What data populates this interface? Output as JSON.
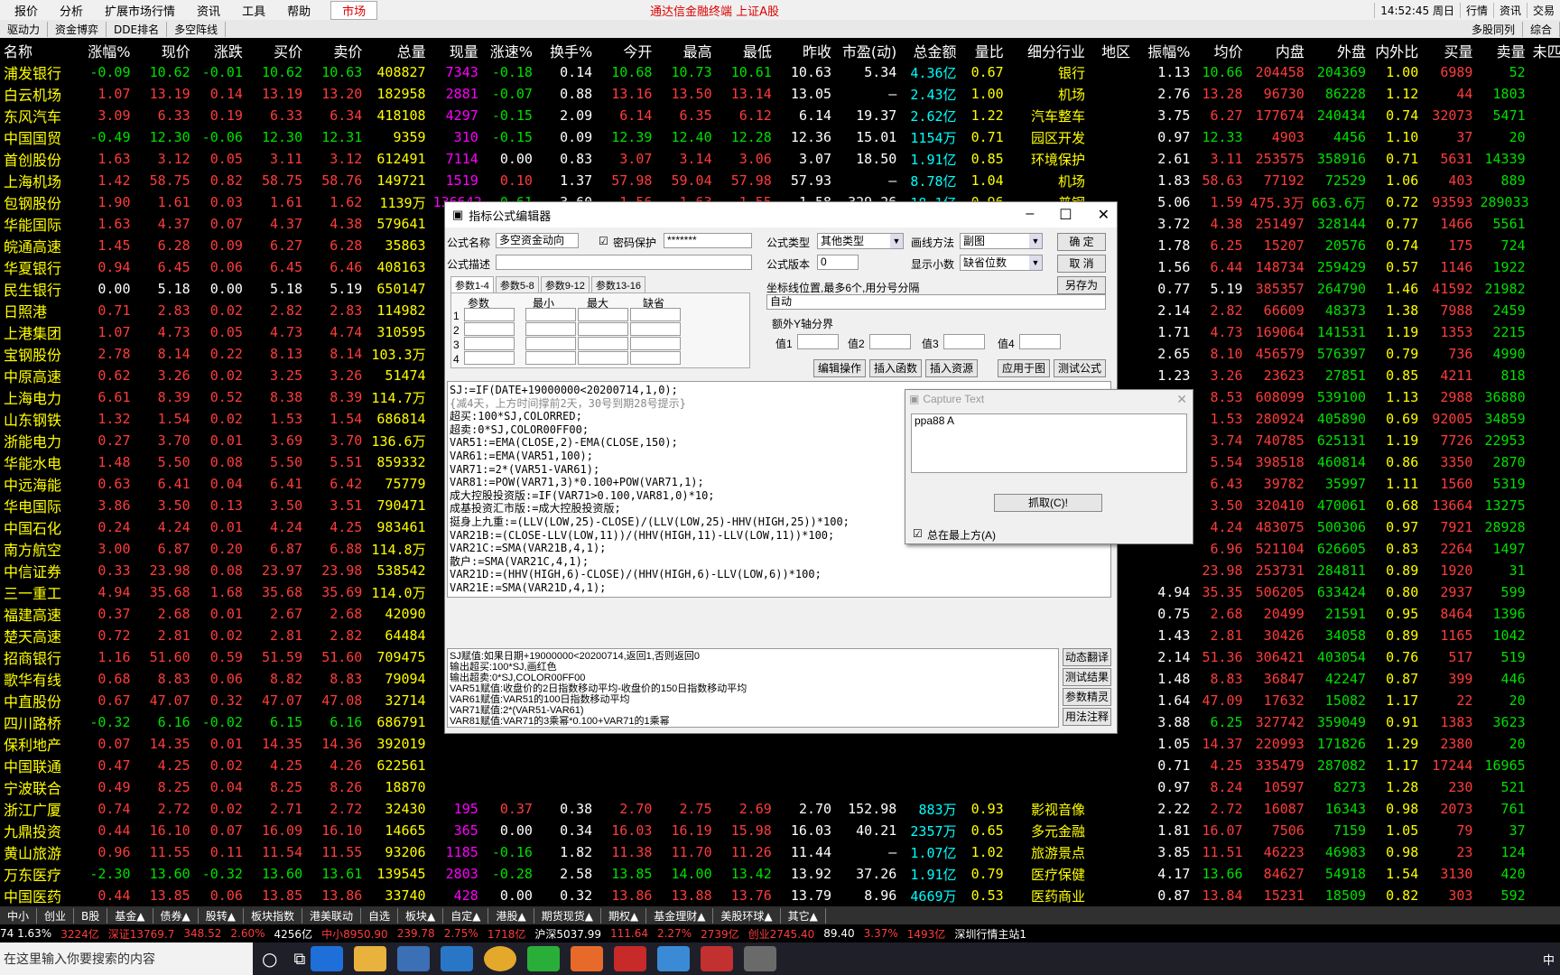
{
  "menu": {
    "items": [
      "报价",
      "分析",
      "扩展市场行情",
      "资讯",
      "工具",
      "帮助"
    ],
    "active": "市场",
    "title": "通达信金融终端  上证A股",
    "time": "14:52:45 周日",
    "right": [
      "行情",
      "资讯",
      "交易"
    ]
  },
  "toolbar2": {
    "items": [
      "驱动力",
      "资金博弈",
      "DDE排名",
      "多空阵线"
    ],
    "right": [
      "多股同列",
      "综合"
    ]
  },
  "headers": [
    "名称",
    "涨幅%",
    "现价",
    "涨跌",
    "买价",
    "卖价",
    "总量",
    "现量",
    "涨速%",
    "换手%",
    "今开",
    "最高",
    "最低",
    "昨收",
    "市盈(动)",
    "总金额",
    "量比",
    "细分行业",
    "地区",
    "振幅%",
    "均价",
    "内盘",
    "外盘",
    "内外比",
    "买量",
    "卖量",
    "未匹"
  ],
  "rows": [
    [
      "浦发银行",
      "-0.09",
      "10.62",
      "-0.01",
      "10.62",
      "10.63",
      "408827",
      "7343",
      "-0.18",
      "0.14",
      "10.68",
      "10.73",
      "10.61",
      "10.63",
      "5.34",
      "4.36亿",
      "0.67",
      "银行",
      "",
      "1.13",
      "10.66",
      "204458",
      "204369",
      "1.00",
      "6989",
      "52"
    ],
    [
      "白云机场",
      "1.07",
      "13.19",
      "0.14",
      "13.19",
      "13.20",
      "182958",
      "2881",
      "-0.07",
      "0.88",
      "13.16",
      "13.50",
      "13.14",
      "13.05",
      "—",
      "2.43亿",
      "1.00",
      "机场",
      "",
      "2.76",
      "13.28",
      "96730",
      "86228",
      "1.12",
      "44",
      "1803"
    ],
    [
      "东风汽车",
      "3.09",
      "6.33",
      "0.19",
      "6.33",
      "6.34",
      "418108",
      "4297",
      "-0.15",
      "2.09",
      "6.14",
      "6.35",
      "6.12",
      "6.14",
      "19.37",
      "2.62亿",
      "1.22",
      "汽车整车",
      "",
      "3.75",
      "6.27",
      "177674",
      "240434",
      "0.74",
      "32073",
      "5471"
    ],
    [
      "中国国贸",
      "-0.49",
      "12.30",
      "-0.06",
      "12.30",
      "12.31",
      "9359",
      "310",
      "-0.15",
      "0.09",
      "12.39",
      "12.40",
      "12.28",
      "12.36",
      "15.01",
      "1154万",
      "0.71",
      "园区开发",
      "",
      "0.97",
      "12.33",
      "4903",
      "4456",
      "1.10",
      "37",
      "20"
    ],
    [
      "首创股份",
      "1.63",
      "3.12",
      "0.05",
      "3.11",
      "3.12",
      "612491",
      "7114",
      "0.00",
      "0.83",
      "3.07",
      "3.14",
      "3.06",
      "3.07",
      "18.50",
      "1.91亿",
      "0.85",
      "环境保护",
      "",
      "2.61",
      "3.11",
      "253575",
      "358916",
      "0.71",
      "5631",
      "14339"
    ],
    [
      "上海机场",
      "1.42",
      "58.75",
      "0.82",
      "58.75",
      "58.76",
      "149721",
      "1519",
      "0.10",
      "1.37",
      "57.98",
      "59.04",
      "57.98",
      "57.93",
      "—",
      "8.78亿",
      "1.04",
      "机场",
      "",
      "1.83",
      "58.63",
      "77192",
      "72529",
      "1.06",
      "403",
      "889"
    ],
    [
      "包钢股份",
      "1.90",
      "1.61",
      "0.03",
      "1.61",
      "1.62",
      "1139万",
      "136642",
      "-0.61",
      "3.60",
      "1.56",
      "1.63",
      "1.55",
      "1.58",
      "329.26",
      "18.1亿",
      "0.96",
      "普钢",
      "",
      "5.06",
      "1.59",
      "475.3万",
      "663.6万",
      "0.72",
      "93593",
      "289033"
    ],
    [
      "华能国际",
      "1.63",
      "4.37",
      "0.07",
      "4.37",
      "4.38",
      "579641",
      "",
      "",
      "",
      "",
      "",
      "",
      "",
      "",
      "",
      "",
      "",
      "",
      "3.72",
      "4.38",
      "251497",
      "328144",
      "0.77",
      "1466",
      "5561"
    ],
    [
      "皖通高速",
      "1.45",
      "6.28",
      "0.09",
      "6.27",
      "6.28",
      "35863",
      "",
      "",
      "",
      "",
      "",
      "",
      "",
      "",
      "",
      "",
      "",
      "",
      "1.78",
      "6.25",
      "15207",
      "20576",
      "0.74",
      "175",
      "724"
    ],
    [
      "华夏银行",
      "0.94",
      "6.45",
      "0.06",
      "6.45",
      "6.46",
      "408163",
      "",
      "",
      "",
      "",
      "",
      "",
      "",
      "",
      "",
      "",
      "",
      "",
      "1.56",
      "6.44",
      "148734",
      "259429",
      "0.57",
      "1146",
      "1922"
    ],
    [
      "民生银行",
      "0.00",
      "5.18",
      "0.00",
      "5.18",
      "5.19",
      "650147",
      "",
      "",
      "",
      "",
      "",
      "",
      "",
      "",
      "",
      "",
      "",
      "",
      "0.77",
      "5.19",
      "385357",
      "264790",
      "1.46",
      "41592",
      "21982"
    ],
    [
      "日照港",
      "0.71",
      "2.83",
      "0.02",
      "2.82",
      "2.83",
      "114982",
      "",
      "",
      "",
      "",
      "",
      "",
      "",
      "",
      "",
      "",
      "",
      "",
      "2.14",
      "2.82",
      "66609",
      "48373",
      "1.38",
      "7988",
      "2459"
    ],
    [
      "上港集团",
      "1.07",
      "4.73",
      "0.05",
      "4.73",
      "4.74",
      "310595",
      "",
      "",
      "",
      "",
      "",
      "",
      "",
      "",
      "",
      "",
      "",
      "",
      "1.71",
      "4.73",
      "169064",
      "141531",
      "1.19",
      "1353",
      "2215"
    ],
    [
      "宝钢股份",
      "2.78",
      "8.14",
      "0.22",
      "8.13",
      "8.14",
      "103.3万",
      "",
      "",
      "",
      "",
      "",
      "",
      "",
      "",
      "",
      "",
      "",
      "",
      "2.65",
      "8.10",
      "456579",
      "576397",
      "0.79",
      "736",
      "4990"
    ],
    [
      "中原高速",
      "0.62",
      "3.26",
      "0.02",
      "3.25",
      "3.26",
      "51474",
      "",
      "",
      "",
      "",
      "",
      "",
      "",
      "",
      "",
      "",
      "",
      "",
      "1.23",
      "3.26",
      "23623",
      "27851",
      "0.85",
      "4211",
      "818"
    ],
    [
      "上海电力",
      "6.61",
      "8.39",
      "0.52",
      "8.38",
      "8.39",
      "114.7万",
      "",
      "",
      "",
      "",
      "",
      "",
      "",
      "",
      "",
      "",
      "",
      "",
      "9.78",
      "8.53",
      "608099",
      "539100",
      "1.13",
      "2988",
      "36880"
    ],
    [
      "山东钢铁",
      "1.32",
      "1.54",
      "0.02",
      "1.53",
      "1.54",
      "686814",
      "",
      "",
      "",
      "",
      "",
      "",
      "",
      "",
      "",
      "",
      "",
      "",
      "1.97",
      "1.53",
      "280924",
      "405890",
      "0.69",
      "92005",
      "34859"
    ],
    [
      "浙能电力",
      "0.27",
      "3.70",
      "0.01",
      "3.69",
      "3.70",
      "136.6万",
      "",
      "",
      "",
      "",
      "",
      "",
      "",
      "",
      "",
      "",
      "",
      "",
      "",
      "3.74",
      "740785",
      "625131",
      "1.19",
      "7726",
      "22953"
    ],
    [
      "华能水电",
      "1.48",
      "5.50",
      "0.08",
      "5.50",
      "5.51",
      "859332",
      "",
      "",
      "",
      "",
      "",
      "",
      "",
      "",
      "",
      "",
      "",
      "",
      "",
      "5.54",
      "398518",
      "460814",
      "0.86",
      "3350",
      "2870"
    ],
    [
      "中远海能",
      "0.63",
      "6.41",
      "0.04",
      "6.41",
      "6.42",
      "75779",
      "",
      "",
      "",
      "",
      "",
      "",
      "",
      "",
      "",
      "",
      "",
      "",
      "",
      "6.43",
      "39782",
      "35997",
      "1.11",
      "1560",
      "5319"
    ],
    [
      "华电国际",
      "3.86",
      "3.50",
      "0.13",
      "3.50",
      "3.51",
      "790471",
      "",
      "",
      "",
      "",
      "",
      "",
      "",
      "",
      "",
      "",
      "",
      "",
      "",
      "3.50",
      "320410",
      "470061",
      "0.68",
      "13664",
      "13275"
    ],
    [
      "中国石化",
      "0.24",
      "4.24",
      "0.01",
      "4.24",
      "4.25",
      "983461",
      "",
      "",
      "",
      "",
      "",
      "",
      "",
      "",
      "",
      "",
      "",
      "",
      "",
      "4.24",
      "483075",
      "500306",
      "0.97",
      "7921",
      "28928"
    ],
    [
      "南方航空",
      "3.00",
      "6.87",
      "0.20",
      "6.87",
      "6.88",
      "114.8万",
      "",
      "",
      "",
      "",
      "",
      "",
      "",
      "",
      "",
      "",
      "",
      "",
      "",
      "6.96",
      "521104",
      "626605",
      "0.83",
      "2264",
      "1497"
    ],
    [
      "中信证券",
      "0.33",
      "23.98",
      "0.08",
      "23.97",
      "23.98",
      "538542",
      "",
      "",
      "",
      "",
      "",
      "",
      "",
      "",
      "",
      "",
      "",
      "",
      "",
      "23.98",
      "253731",
      "284811",
      "0.89",
      "1920",
      "31"
    ],
    [
      "三一重工",
      "4.94",
      "35.68",
      "1.68",
      "35.68",
      "35.69",
      "114.0万",
      "",
      "",
      "",
      "",
      "",
      "",
      "",
      "",
      "",
      "",
      "",
      "",
      "4.94",
      "35.35",
      "506205",
      "633424",
      "0.80",
      "2937",
      "599"
    ],
    [
      "福建高速",
      "0.37",
      "2.68",
      "0.01",
      "2.67",
      "2.68",
      "42090",
      "",
      "",
      "",
      "",
      "",
      "",
      "",
      "",
      "",
      "",
      "",
      "",
      "0.75",
      "2.68",
      "20499",
      "21591",
      "0.95",
      "8464",
      "1396"
    ],
    [
      "楚天高速",
      "0.72",
      "2.81",
      "0.02",
      "2.81",
      "2.82",
      "64484",
      "",
      "",
      "",
      "",
      "",
      "",
      "",
      "",
      "",
      "",
      "",
      "",
      "1.43",
      "2.81",
      "30426",
      "34058",
      "0.89",
      "1165",
      "1042"
    ],
    [
      "招商银行",
      "1.16",
      "51.60",
      "0.59",
      "51.59",
      "51.60",
      "709475",
      "",
      "",
      "",
      "",
      "",
      "",
      "",
      "",
      "",
      "",
      "",
      "",
      "2.14",
      "51.36",
      "306421",
      "403054",
      "0.76",
      "517",
      "519"
    ],
    [
      "歌华有线",
      "0.68",
      "8.83",
      "0.06",
      "8.82",
      "8.83",
      "79094",
      "",
      "",
      "",
      "",
      "",
      "",
      "",
      "",
      "",
      "",
      "",
      "",
      "1.48",
      "8.83",
      "36847",
      "42247",
      "0.87",
      "399",
      "446"
    ],
    [
      "中直股份",
      "0.67",
      "47.07",
      "0.32",
      "47.07",
      "47.08",
      "32714",
      "",
      "",
      "",
      "",
      "",
      "",
      "",
      "",
      "",
      "",
      "",
      "",
      "1.64",
      "47.09",
      "17632",
      "15082",
      "1.17",
      "22",
      "20"
    ],
    [
      "四川路桥",
      "-0.32",
      "6.16",
      "-0.02",
      "6.15",
      "6.16",
      "686791",
      "",
      "",
      "",
      "",
      "",
      "",
      "",
      "",
      "",
      "",
      "",
      "",
      "3.88",
      "6.25",
      "327742",
      "359049",
      "0.91",
      "1383",
      "3623"
    ],
    [
      "保利地产",
      "0.07",
      "14.35",
      "0.01",
      "14.35",
      "14.36",
      "392019",
      "",
      "",
      "",
      "",
      "",
      "",
      "",
      "",
      "",
      "",
      "",
      "",
      "1.05",
      "14.37",
      "220993",
      "171826",
      "1.29",
      "2380",
      "20"
    ],
    [
      "中国联通",
      "0.47",
      "4.25",
      "0.02",
      "4.25",
      "4.26",
      "622561",
      "",
      "",
      "",
      "",
      "",
      "",
      "",
      "",
      "",
      "",
      "",
      "",
      "0.71",
      "4.25",
      "335479",
      "287082",
      "1.17",
      "17244",
      "16965"
    ],
    [
      "宁波联合",
      "0.49",
      "8.25",
      "0.04",
      "8.25",
      "8.26",
      "18870",
      "",
      "",
      "",
      "",
      "",
      "",
      "",
      "",
      "",
      "",
      "",
      "",
      "0.97",
      "8.24",
      "10597",
      "8273",
      "1.28",
      "230",
      "521"
    ],
    [
      "浙江广厦",
      "0.74",
      "2.72",
      "0.02",
      "2.71",
      "2.72",
      "32430",
      "195",
      "0.37",
      "0.38",
      "2.70",
      "2.75",
      "2.69",
      "2.70",
      "152.98",
      "883万",
      "0.93",
      "影视音像",
      "",
      "2.22",
      "2.72",
      "16087",
      "16343",
      "0.98",
      "2073",
      "761"
    ],
    [
      "九鼎投资",
      "0.44",
      "16.10",
      "0.07",
      "16.09",
      "16.10",
      "14665",
      "365",
      "0.00",
      "0.34",
      "16.03",
      "16.19",
      "15.98",
      "16.03",
      "40.21",
      "2357万",
      "0.65",
      "多元金融",
      "",
      "1.81",
      "16.07",
      "7506",
      "7159",
      "1.05",
      "79",
      "37"
    ],
    [
      "黄山旅游",
      "0.96",
      "11.55",
      "0.11",
      "11.54",
      "11.55",
      "93206",
      "1185",
      "-0.16",
      "1.82",
      "11.38",
      "11.70",
      "11.26",
      "11.44",
      "—",
      "1.07亿",
      "1.02",
      "旅游景点",
      "",
      "3.85",
      "11.51",
      "46223",
      "46983",
      "0.98",
      "23",
      "124"
    ],
    [
      "万东医疗",
      "-2.30",
      "13.60",
      "-0.32",
      "13.60",
      "13.61",
      "139545",
      "2803",
      "-0.28",
      "2.58",
      "13.85",
      "14.00",
      "13.42",
      "13.92",
      "37.26",
      "1.91亿",
      "0.79",
      "医疗保健",
      "",
      "4.17",
      "13.66",
      "84627",
      "54918",
      "1.54",
      "3130",
      "420"
    ],
    [
      "中国医药",
      "0.44",
      "13.85",
      "0.06",
      "13.85",
      "13.86",
      "33740",
      "428",
      "0.00",
      "0.32",
      "13.86",
      "13.88",
      "13.76",
      "13.79",
      "8.96",
      "4669万",
      "0.53",
      "医药商业",
      "",
      "0.87",
      "13.84",
      "15231",
      "18509",
      "0.82",
      "303",
      "592"
    ],
    [
      "厦门象屿",
      "4.77",
      "6.37",
      "0.29",
      "6.36",
      "6.37",
      "248300",
      "2661",
      "0.00",
      "1.16",
      "6.10",
      "6.40",
      "6.08",
      "6.08",
      "11.05",
      "1.57亿",
      "1.44",
      "仓储物流",
      "",
      "5.26",
      "6.31",
      "82401",
      "165899",
      "0.50",
      "175",
      "1196"
    ],
    [
      "五矿发展",
      "2.04",
      "8.01",
      "0.16",
      "8.00",
      "8.01",
      "98244",
      "2708",
      "0.00",
      "0.92",
      "7.79",
      "8.04",
      "7.65",
      "7.85",
      "26.01",
      "7767万",
      "0.84",
      "商贸代理",
      "",
      "4.97",
      "7.91",
      "50037",
      "48207",
      "1.04",
      "419",
      "1435"
    ],
    [
      "古越龙山",
      "1.50",
      "11.54",
      "0.17",
      "11.53",
      "11.54",
      "197928",
      "2848",
      "0.00",
      "2.45",
      "11.34",
      "11.72",
      "11.24",
      "11.37",
      "81.51",
      "2.28亿",
      "0.96",
      "红黄药酒",
      "",
      "4.22",
      "11.50",
      "87404",
      "110524",
      "0.79",
      "225",
      "42"
    ]
  ],
  "bottom_tabs": [
    "中小",
    "创业",
    "B股",
    "基金▲",
    "债券▲",
    "股转▲",
    "板块指数",
    "港美联动",
    "自选",
    "板块▲",
    "自定▲",
    "港股▲",
    "期货现货▲",
    "期权▲",
    "基金理财▲",
    "美股环球▲",
    "其它▲"
  ],
  "index_bar": [
    "74 1.63%",
    "3224亿",
    "深证13769.7",
    "348.52",
    "2.60%",
    "4256亿",
    "中小8950.90",
    "239.78",
    "2.75%",
    "1718亿",
    "沪深5037.99",
    "111.64",
    "2.27%",
    "2739亿",
    "创业2745.40",
    "89.40",
    "3.37%",
    "1493亿",
    "深圳行情主站1"
  ],
  "dialog": {
    "title": "指标公式编辑器",
    "formula_name_label": "公式名称",
    "formula_name": "多空资金动向",
    "pwd_label": "密码保护",
    "pwd": "*******",
    "desc_label": "公式描述",
    "type_label": "公式类型",
    "type": "其他类型",
    "draw_label": "画线方法",
    "draw": "副图",
    "ver_label": "公式版本",
    "ver": "0",
    "decimals_label": "显示小数",
    "decimals": "缺省位数",
    "ok": "确  定",
    "cancel": "取  消",
    "save_as": "另存为",
    "tabs": [
      "参数1-4",
      "参数5-8",
      "参数9-12",
      "参数13-16"
    ],
    "param_headers": [
      "参数",
      "最小",
      "最大",
      "缺省"
    ],
    "axis_label": "坐标线位置,最多6个,用分号分隔",
    "axis_value": "自动",
    "extra_y": "额外Y轴分界",
    "vals": [
      "值1",
      "值2",
      "值3",
      "值4"
    ],
    "actions": [
      "编辑操作",
      "插入函数",
      "插入资源",
      "应用于图",
      "测试公式"
    ],
    "code": [
      "SJ:=IF(DATE+19000000<20200714,1,0);",
      "{减4天，上方时间撑前2天，30号到期28号提示}",
      "",
      "超买:100*SJ,COLORRED;",
      "超卖:0*SJ,COLOR00FF00;",
      "",
      "VAR51:=EMA(CLOSE,2)-EMA(CLOSE,150);",
      "VAR61:=EMA(VAR51,100);",
      "VAR71:=2*(VAR51-VAR61);",
      "VAR81:=POW(VAR71,3)*0.100+POW(VAR71,1);",
      "成大控股投资版:=IF(VAR71>0.100,VAR81,0)*10;",
      "成基投资汇市版:=成大控股投资版;",
      "挺身上九重:=(LLV(LOW,25)-CLOSE)/(LLV(LOW,25)-HHV(HIGH,25))*100;",
      "VAR21B:=(CLOSE-LLV(LOW,11))/(HHV(HIGH,11)-LLV(LOW,11))*100;",
      "VAR21C:=SMA(VAR21B,4,1);",
      "散户:=SMA(VAR21C,4,1);",
      "VAR21D:=(HHV(HIGH,6)-CLOSE)/(HHV(HIGH,6)-LLV(LOW,6))*100;",
      "VAR21E:=SMA(VAR21D,4,1);"
    ],
    "info": [
      "SJ赋值:如果日期+19000000<20200714,返回1,否则返回0",
      "输出超买:100*SJ,画红色",
      "输出超卖:0*SJ,COLOR00FF00",
      "VAR51赋值:收盘价的2日指数移动平均-收盘价的150日指数移动平均",
      "VAR61赋值:VAR51的100日指数移动平均",
      "VAR71赋值:2*(VAR51-VAR61)",
      "VAR81赋值:VAR71的3乘幂*0.100+VAR71的1乘幂"
    ],
    "side_btns": [
      "动态翻译",
      "测试结果",
      "参数精灵",
      "用法注释"
    ]
  },
  "capture": {
    "title": "Capture Text",
    "text": "ppa88 A",
    "btn": "抓取(C)!",
    "chk": "总在最上方(A)"
  },
  "taskbar": {
    "search": "在这里输入你要搜索的内容",
    "tray": "中"
  }
}
